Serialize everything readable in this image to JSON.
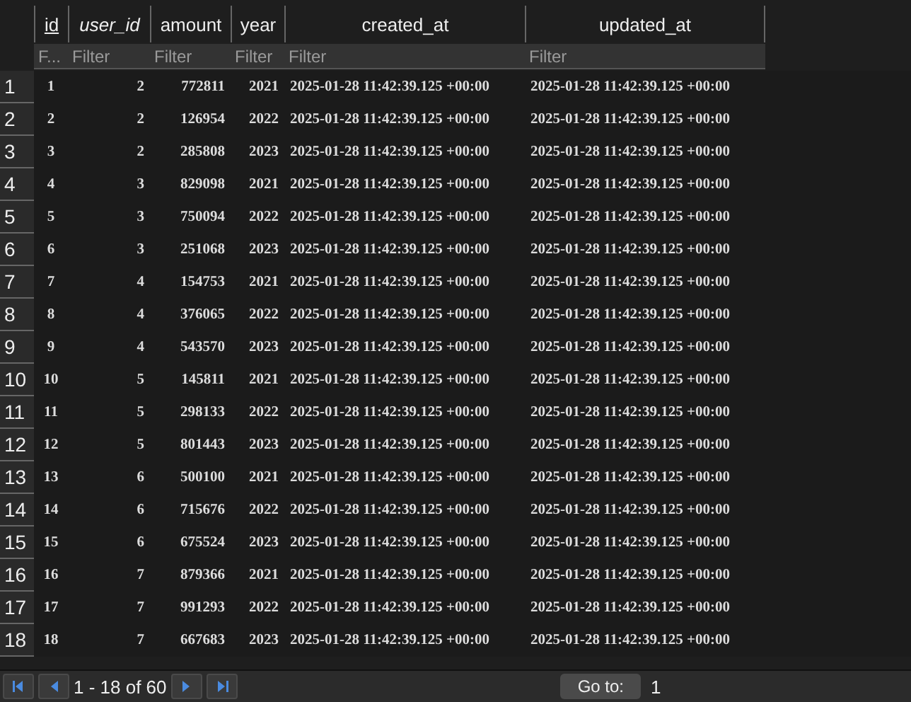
{
  "table": {
    "columns": [
      {
        "label": "id",
        "kind": "primary",
        "filter_placeholder": "F..."
      },
      {
        "label": "user_id",
        "kind": "foreign",
        "filter_placeholder": "Filter"
      },
      {
        "label": "amount",
        "kind": "plain",
        "filter_placeholder": "Filter"
      },
      {
        "label": "year",
        "kind": "plain",
        "filter_placeholder": "Filter"
      },
      {
        "label": "created_at",
        "kind": "plain",
        "filter_placeholder": "Filter"
      },
      {
        "label": "updated_at",
        "kind": "plain",
        "filter_placeholder": "Filter"
      }
    ],
    "rows": [
      {
        "number": "1",
        "cells": [
          "1",
          "2",
          "772811",
          "2021",
          "2025-01-28 11:42:39.125 +00:00",
          "2025-01-28 11:42:39.125 +00:00"
        ]
      },
      {
        "number": "2",
        "cells": [
          "2",
          "2",
          "126954",
          "2022",
          "2025-01-28 11:42:39.125 +00:00",
          "2025-01-28 11:42:39.125 +00:00"
        ]
      },
      {
        "number": "3",
        "cells": [
          "3",
          "2",
          "285808",
          "2023",
          "2025-01-28 11:42:39.125 +00:00",
          "2025-01-28 11:42:39.125 +00:00"
        ]
      },
      {
        "number": "4",
        "cells": [
          "4",
          "3",
          "829098",
          "2021",
          "2025-01-28 11:42:39.125 +00:00",
          "2025-01-28 11:42:39.125 +00:00"
        ]
      },
      {
        "number": "5",
        "cells": [
          "5",
          "3",
          "750094",
          "2022",
          "2025-01-28 11:42:39.125 +00:00",
          "2025-01-28 11:42:39.125 +00:00"
        ]
      },
      {
        "number": "6",
        "cells": [
          "6",
          "3",
          "251068",
          "2023",
          "2025-01-28 11:42:39.125 +00:00",
          "2025-01-28 11:42:39.125 +00:00"
        ]
      },
      {
        "number": "7",
        "cells": [
          "7",
          "4",
          "154753",
          "2021",
          "2025-01-28 11:42:39.125 +00:00",
          "2025-01-28 11:42:39.125 +00:00"
        ]
      },
      {
        "number": "8",
        "cells": [
          "8",
          "4",
          "376065",
          "2022",
          "2025-01-28 11:42:39.125 +00:00",
          "2025-01-28 11:42:39.125 +00:00"
        ]
      },
      {
        "number": "9",
        "cells": [
          "9",
          "4",
          "543570",
          "2023",
          "2025-01-28 11:42:39.125 +00:00",
          "2025-01-28 11:42:39.125 +00:00"
        ]
      },
      {
        "number": "10",
        "cells": [
          "10",
          "5",
          "145811",
          "2021",
          "2025-01-28 11:42:39.125 +00:00",
          "2025-01-28 11:42:39.125 +00:00"
        ]
      },
      {
        "number": "11",
        "cells": [
          "11",
          "5",
          "298133",
          "2022",
          "2025-01-28 11:42:39.125 +00:00",
          "2025-01-28 11:42:39.125 +00:00"
        ]
      },
      {
        "number": "12",
        "cells": [
          "12",
          "5",
          "801443",
          "2023",
          "2025-01-28 11:42:39.125 +00:00",
          "2025-01-28 11:42:39.125 +00:00"
        ]
      },
      {
        "number": "13",
        "cells": [
          "13",
          "6",
          "500100",
          "2021",
          "2025-01-28 11:42:39.125 +00:00",
          "2025-01-28 11:42:39.125 +00:00"
        ]
      },
      {
        "number": "14",
        "cells": [
          "14",
          "6",
          "715676",
          "2022",
          "2025-01-28 11:42:39.125 +00:00",
          "2025-01-28 11:42:39.125 +00:00"
        ]
      },
      {
        "number": "15",
        "cells": [
          "15",
          "6",
          "675524",
          "2023",
          "2025-01-28 11:42:39.125 +00:00",
          "2025-01-28 11:42:39.125 +00:00"
        ]
      },
      {
        "number": "16",
        "cells": [
          "16",
          "7",
          "879366",
          "2021",
          "2025-01-28 11:42:39.125 +00:00",
          "2025-01-28 11:42:39.125 +00:00"
        ]
      },
      {
        "number": "17",
        "cells": [
          "17",
          "7",
          "991293",
          "2022",
          "2025-01-28 11:42:39.125 +00:00",
          "2025-01-28 11:42:39.125 +00:00"
        ]
      },
      {
        "number": "18",
        "cells": [
          "18",
          "7",
          "667683",
          "2023",
          "2025-01-28 11:42:39.125 +00:00",
          "2025-01-28 11:42:39.125 +00:00"
        ]
      }
    ]
  },
  "pager": {
    "range": "1 - 18 of 60",
    "goto_label": "Go to:",
    "goto_value": "1"
  }
}
